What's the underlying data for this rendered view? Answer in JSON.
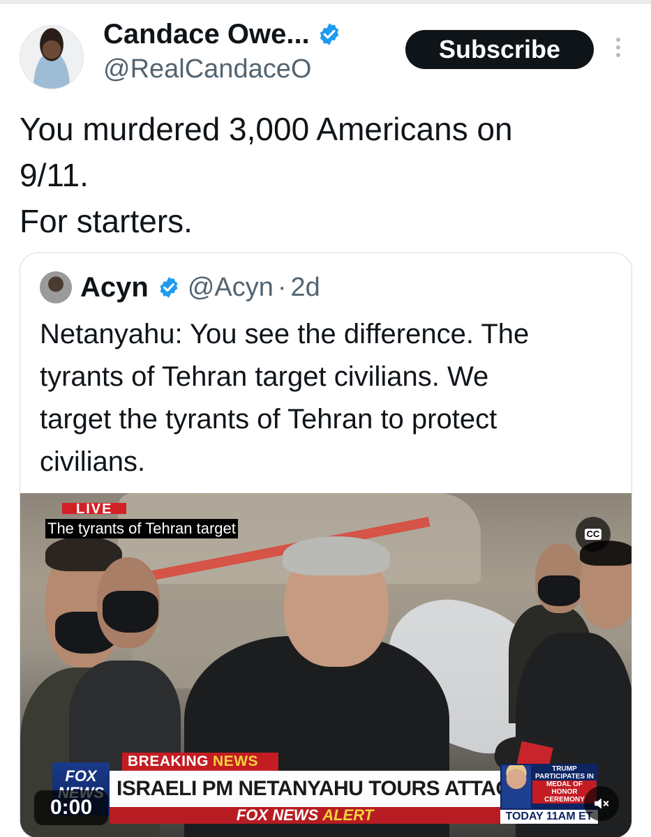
{
  "post": {
    "author": {
      "display_name": "Candace Owe...",
      "handle": "@RealCandaceO"
    },
    "subscribe_label": "Subscribe",
    "text_lines": [
      "You murdered 3,000 Americans on",
      "9/11.",
      "For starters."
    ]
  },
  "quote": {
    "author": {
      "display_name": "Acyn",
      "handle": "@Acyn",
      "time": "2d",
      "separator": "·"
    },
    "text_lines": [
      "Netanyahu: You see the difference. The",
      "tyrants of Tehran target civilians. We",
      "target the tyrants of Tehran to protect",
      "civilians."
    ],
    "video": {
      "live_tag": "LIVE",
      "caption": "The tyrants of Tehran target",
      "cc_label": "CC",
      "breaking_label": "BREAKING",
      "breaking_label_accent": "NEWS",
      "network_logo": "FOX NEWS",
      "headline": "ISRAELI PM NETANYAHU TOURS ATTACK SITE",
      "alert_label": "FOX NEWS",
      "alert_label_accent": "ALERT",
      "promo": {
        "line1": "TRUMP",
        "line2": "PARTICIPATES IN",
        "line3": "MEDAL OF HONOR",
        "line4": "CEREMONY",
        "time": "TODAY 11AM ET"
      },
      "timestamp": "0:00"
    }
  },
  "colors": {
    "verified_blue": "#1d9bf0",
    "text_primary": "#0f1419",
    "text_secondary": "#536471",
    "fox_red": "#c31d23",
    "fox_blue": "#0c2462"
  },
  "icons": {
    "verified": "verified-badge-icon",
    "more": "more-vertical-icon",
    "cc": "closed-captions-icon",
    "volume": "volume-icon"
  }
}
